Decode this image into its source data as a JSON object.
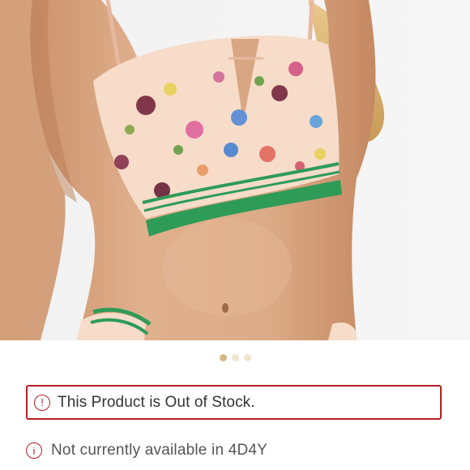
{
  "product_image": {
    "alt": "",
    "carousel": {
      "count": 3,
      "active_index": 0
    }
  },
  "stock_alert": {
    "icon": "exclamation-circle-icon",
    "message": "This Product is Out of Stock."
  },
  "availability": {
    "icon": "info-circle-icon",
    "message": "Not currently available in 4D4Y"
  },
  "colors": {
    "alert_red": "#b62025",
    "dot_active": "#d6b888",
    "dot_inactive": "#efe4cf"
  }
}
